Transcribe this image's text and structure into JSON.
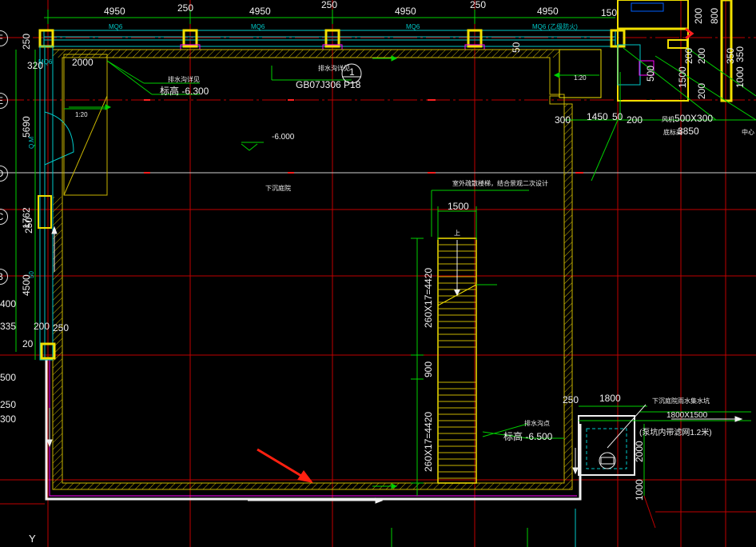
{
  "grid_axes": [
    "F",
    "E",
    "D",
    "C",
    "B"
  ],
  "axis_y": "Y",
  "top_dims": [
    "4950",
    "250",
    "4950",
    "250",
    "4950",
    "250",
    "4950",
    "150",
    "200",
    "800",
    "350"
  ],
  "wall_tags": [
    "MQ6",
    "MQ6",
    "MQ6",
    "MQ6",
    "MQ6 (乙级防火)"
  ],
  "left_dims": [
    "250",
    "320",
    "5690",
    "Q.M",
    "1762",
    "250",
    "50",
    "4500",
    "400",
    "335",
    "200",
    "20",
    "250",
    "500",
    "250",
    "300"
  ],
  "labels": {
    "sump_1": "排水沟详见",
    "sump_1_ref": "GB07J306 P18",
    "sump_1_num": "1",
    "elev_top": "标高 -6.300",
    "dim_2000": "2000",
    "slope_1": "1:20",
    "slope_2": "1:20",
    "elev_mid": "-6.000",
    "area_name": "下沉庭院",
    "stair_note": "室外疏散楼梯，结合景观二次设计",
    "dim_1500": "1500",
    "stair_up": "上",
    "stair_dim_1": "260X17=4420",
    "stair_dim_2": "900",
    "stair_dim_3": "260X17=4420",
    "elev_bottom": "标高 -6.500",
    "drain_label": "排水沟点",
    "dim_1800": "1800",
    "pit_label": "下沉庭院雨水集水坑",
    "pit_size": "1800X1500",
    "pit_pump": "(泵坑内带滤网1.2米)",
    "dim_2000b": "2000",
    "dim_1000": "1000",
    "dim_250": "250",
    "dim_300": "300",
    "dim_1450": "1450",
    "dim_50": "50",
    "dim_200": "200",
    "vent_label": "风机",
    "vent_size": "500X300",
    "vent_elev": "底标高",
    "vent_elev_val": "3850",
    "right_dims": [
      "500",
      "1500",
      "200",
      "200",
      "1000",
      "350",
      "200"
    ],
    "right_tag": "50",
    "center_label": "中心"
  },
  "colors": {
    "background": "#000000",
    "grid": "#c00000",
    "wall_yellow": "#f2e000",
    "hatch": "#c8b400",
    "cyan": "#00c8c8",
    "green": "#00d000",
    "white": "#f0f0f0",
    "magenta": "#ff00ff",
    "arrow": "#ff2010"
  }
}
